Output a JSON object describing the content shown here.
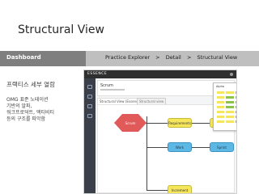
{
  "slide": {
    "title": "Structural View"
  },
  "nav": {
    "section": "Dashboard",
    "breadcrumb": [
      "Practice Explorer",
      "Detail",
      "Structural View"
    ],
    "separator": ">"
  },
  "description": {
    "heading": "프랙티스 세부 열람",
    "lines": [
      "OMG 표준 노테이션",
      "기반의 알파,",
      "워크프로덕트, 액티비티",
      "등의 구조를 파악함"
    ]
  },
  "app": {
    "brand": "ESSENCE",
    "card_title": "Scrum",
    "view_tab": "Structural View (Essence)",
    "view_tab2": "Structural view",
    "popup_title": "Alpha",
    "nodes": {
      "center": "Scrum",
      "n1": "Requirements",
      "n2": "Backlog",
      "n3": "Work",
      "n4": "Sprint",
      "n5": "Increment"
    },
    "colors": {
      "topbar": "#2f2f2f",
      "sidebar": "#3a3f4a",
      "yellow": "#f5e65a",
      "blue": "#5db8e6",
      "red": "#e05a5a"
    }
  }
}
